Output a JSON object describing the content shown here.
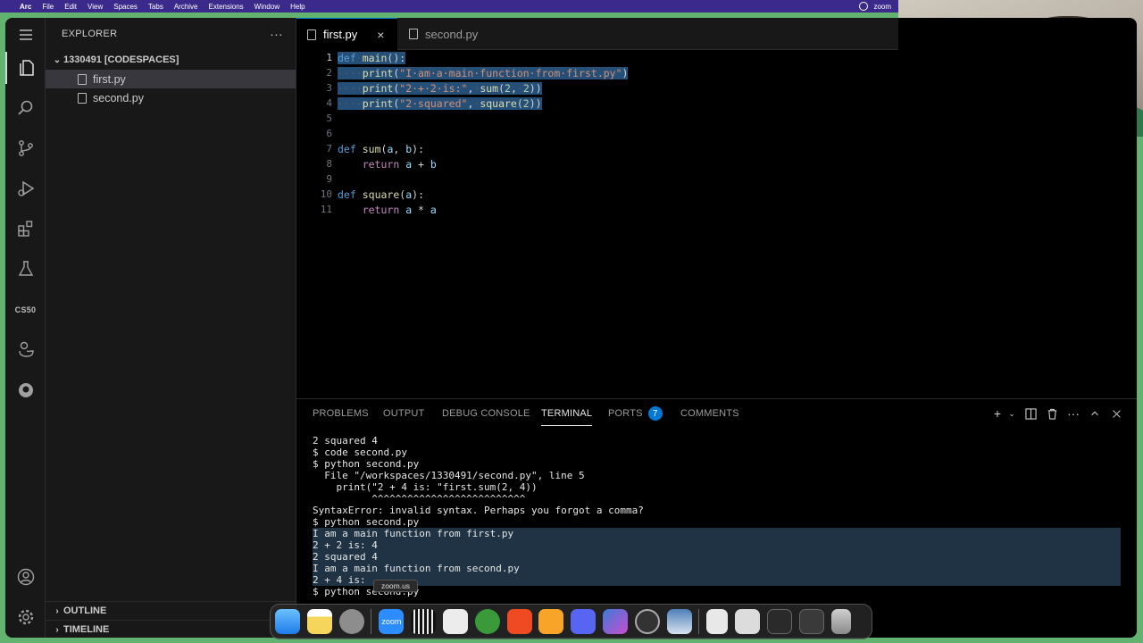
{
  "menubar": {
    "items": [
      "Arc",
      "File",
      "Edit",
      "View",
      "Spaces",
      "Tabs",
      "Archive",
      "Extensions",
      "Window",
      "Help"
    ],
    "right_label": "zoom"
  },
  "activity_bar": {
    "icons": [
      "files-icon",
      "search-icon",
      "source-control-icon",
      "run-debug-icon",
      "extensions-icon",
      "testing-icon",
      "cs50-icon",
      "duck-icon",
      "github-icon",
      "account-icon",
      "settings-gear-icon"
    ],
    "cs50_label": "CS50"
  },
  "sidebar": {
    "title": "EXPLORER",
    "more": "···",
    "folder": "1330491 [CODESPACES]",
    "files": [
      "first.py",
      "second.py"
    ],
    "outline": "OUTLINE",
    "timeline": "TIMELINE"
  },
  "tabs": [
    {
      "label": "first.py",
      "close": "×"
    },
    {
      "label": "second.py"
    }
  ],
  "editor": {
    "line_numbers": [
      "1",
      "2",
      "3",
      "4",
      "5",
      "6",
      "7",
      "8",
      "9",
      "10",
      "11"
    ]
  },
  "panel": {
    "tabs": [
      "PROBLEMS",
      "OUTPUT",
      "DEBUG CONSOLE",
      "TERMINAL",
      "PORTS",
      "COMMENTS"
    ],
    "ports_badge": "7",
    "terminal_lines": [
      "2 squared 4",
      "$ code second.py",
      "$ python second.py",
      "  File \"/workspaces/1330491/second.py\", line 5",
      "    print(\"2 + 4 is: \"first.sum(2, 4))",
      "          ^^^^^^^^^^^^^^^^^^^^^^^^^^",
      "SyntaxError: invalid syntax. Perhaps you forgot a comma?",
      "$ python second.py",
      "I am a main function from first.py",
      "2 + 2 is: 4",
      "2 squared 4",
      "I am a main function from second.py",
      "2 + 4 is:",
      "$ python second.py"
    ]
  },
  "dock": {
    "tooltip": "zoom.us",
    "zoom_label": "zoom"
  },
  "colors": {
    "accent": "#0078d4",
    "menubar": "#3b2a8c",
    "selection": "#264f78",
    "background_frame": "#62b36f"
  }
}
